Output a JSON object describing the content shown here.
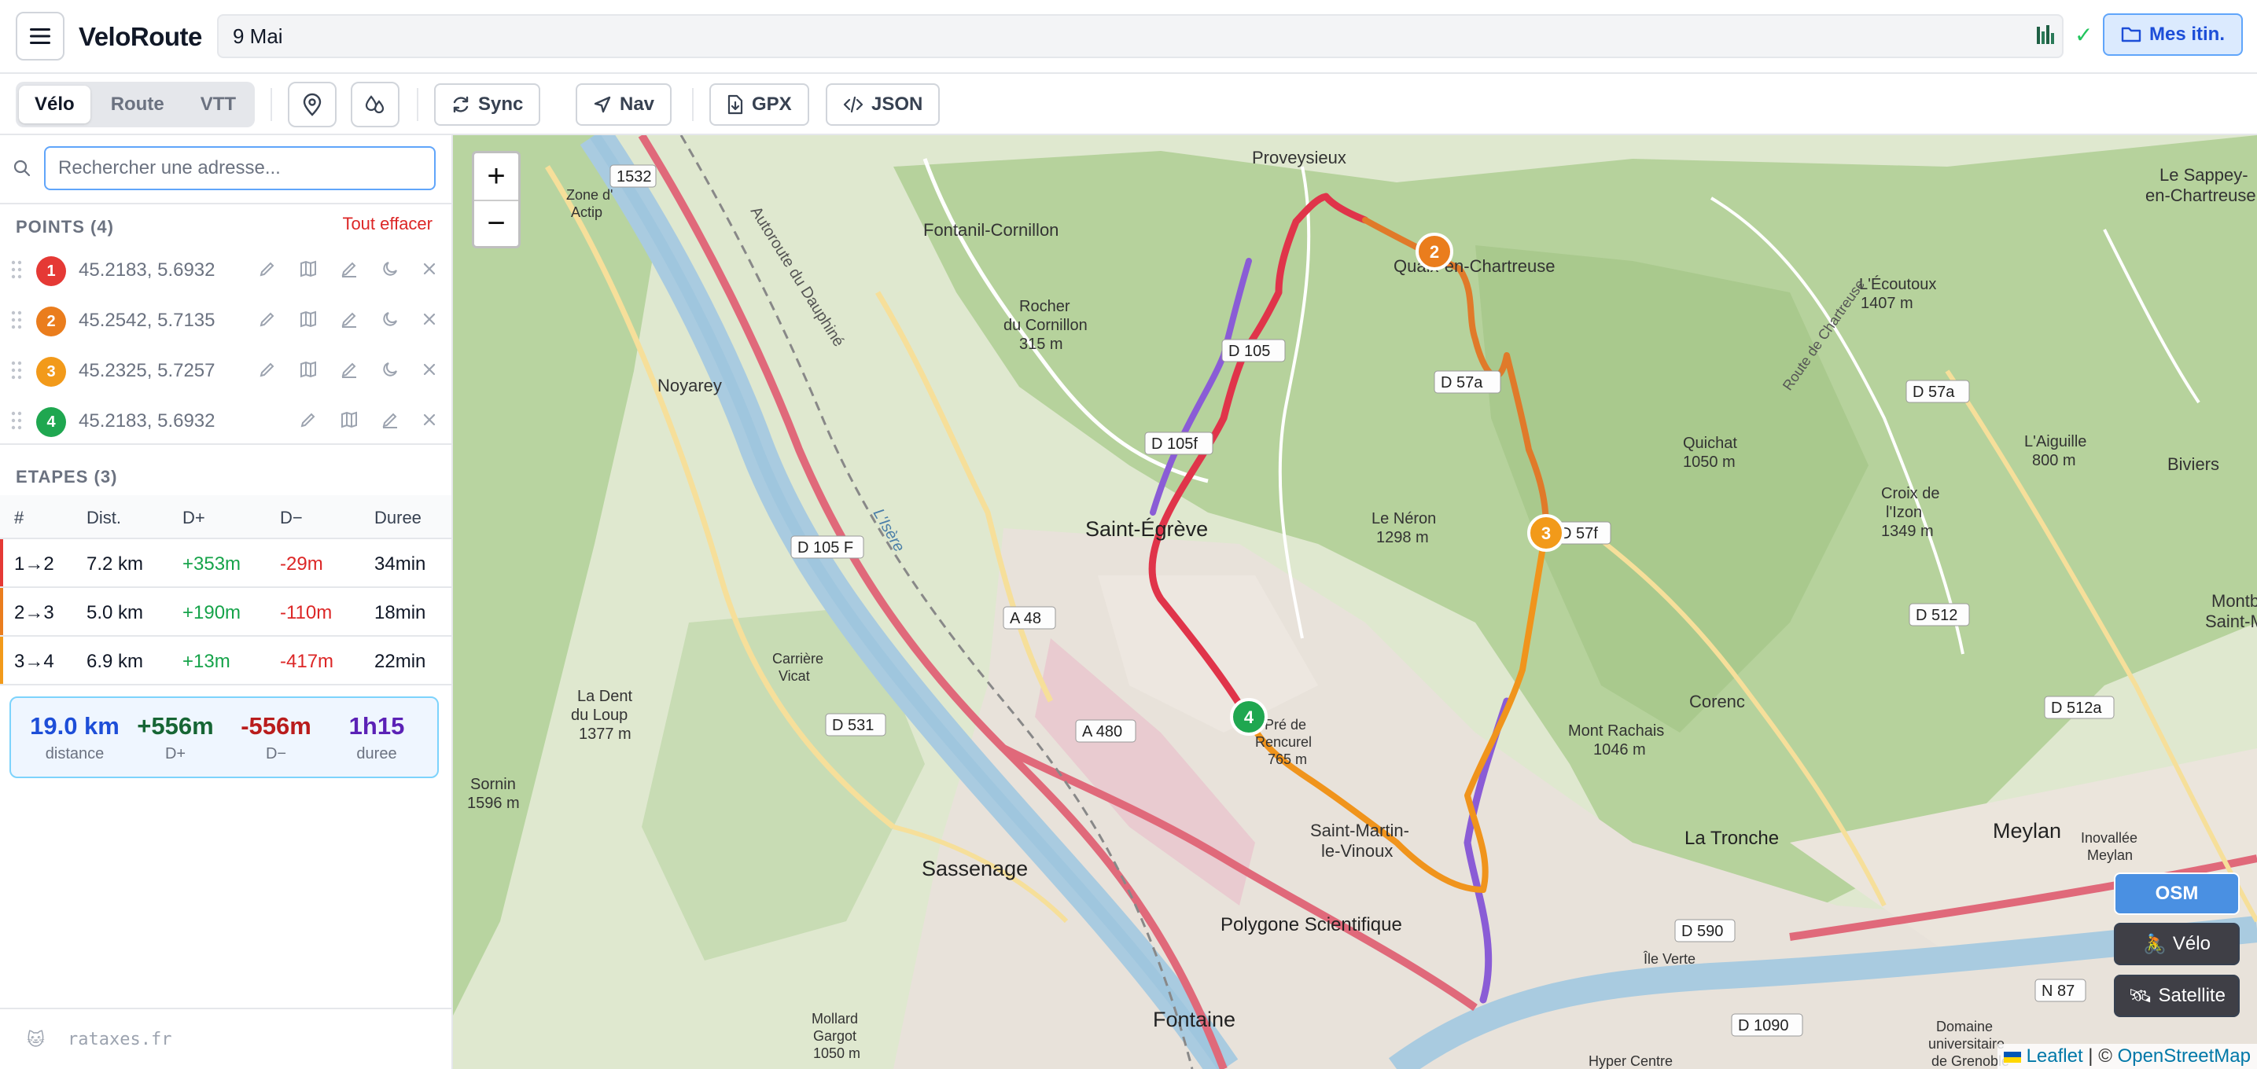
{
  "app": {
    "brand": "VeloRoute",
    "title_value": "9 Mai",
    "my_routes_label": "Mes itin."
  },
  "toolbar": {
    "modes": [
      "Vélo",
      "Route",
      "VTT"
    ],
    "active_mode": "Vélo",
    "sync_label": "Sync",
    "nav_label": "Nav",
    "gpx_label": "GPX",
    "json_label": "JSON"
  },
  "search": {
    "placeholder": "Rechercher une adresse..."
  },
  "points": {
    "title": "POINTS (4)",
    "clear_label": "Tout effacer",
    "items": [
      {
        "n": "1",
        "coord": "45.2183, 5.6932",
        "color": "#e53935"
      },
      {
        "n": "2",
        "coord": "45.2542, 5.7135",
        "color": "#ea7d1d"
      },
      {
        "n": "3",
        "coord": "45.2325, 5.7257",
        "color": "#f29a1a"
      },
      {
        "n": "4",
        "coord": "45.2183, 5.6932",
        "color": "#1fa750"
      }
    ]
  },
  "stages": {
    "title": "ETAPES (3)",
    "headers": [
      "#",
      "Dist.",
      "D+",
      "D−",
      "Duree"
    ],
    "rows": [
      {
        "seg": "1→2",
        "dist": "7.2 km",
        "up": "+353m",
        "down": "-29m",
        "dur": "34min",
        "color": "#e53935"
      },
      {
        "seg": "2→3",
        "dist": "5.0 km",
        "up": "+190m",
        "down": "-110m",
        "dur": "18min",
        "color": "#ea7d1d"
      },
      {
        "seg": "3→4",
        "dist": "6.9 km",
        "up": "+13m",
        "down": "-417m",
        "dur": "22min",
        "color": "#f29a1a"
      }
    ]
  },
  "summary": {
    "distance": "19.0 km",
    "distance_label": "distance",
    "up": "+556m",
    "up_label": "D+",
    "down": "-556m",
    "down_label": "D−",
    "duration": "1h15",
    "duration_label": "duree"
  },
  "footer": {
    "site": "rataxes.fr"
  },
  "map": {
    "zoom_in": "+",
    "zoom_out": "−",
    "layers": {
      "osm": "OSM",
      "velo": "Vélo",
      "satellite": "Satellite"
    },
    "attribution": {
      "leaflet": "Leaflet",
      "sep": " | © ",
      "osm": "OpenStreetMap"
    },
    "labels": {
      "proveysieux": "Proveysieux",
      "fontanil": "Fontanil-Cornillon",
      "noyarey": "Noyarey",
      "st_egreve": "Saint-Égrève",
      "sassenage": "Sassenage",
      "fontaine": "Fontaine",
      "polygone": "Polygone Scientifique",
      "st_martin": "Saint-Martin-",
      "st_martin2": "le-Vinoux",
      "la_tronche": "La Tronche",
      "meylan": "Meylan",
      "corenc": "Corenc",
      "biviers": "Biviers",
      "montbo": "Montbo",
      "saint_m": "Saint-M",
      "sappey": "Le Sappey-",
      "sappey2": "en-Chartreuse",
      "quaix": "Quaix-en-Chartreuse",
      "neron": "Le Néron",
      "neron_alt": "1298 m",
      "rachais": "Mont Rachais",
      "rachais_alt": "1046 m",
      "quichat": "Quichat",
      "quichat_alt": "1050 m",
      "ecoutoux": "L'Écoutoux",
      "ecoutoux_alt": "1407 m",
      "aiguille": "L'Aiguille",
      "aiguille_alt": "800 m",
      "croix": "Croix de",
      "croix2": "l'Izon",
      "croix_alt": "1349 m",
      "dent": "La Dent",
      "dent2": "du Loup",
      "dent_alt": "1377 m",
      "sornin": "Sornin",
      "sornin_alt": "1596 m",
      "rocher": "Rocher",
      "rocher2": "du Cornillon",
      "rocher_alt": "315 m",
      "zone": "Zone d'",
      "zone2": "Actip",
      "carriere": "Carrière",
      "carriere2": "Vicat",
      "pre": "Pré de",
      "pre2": "Rencurel",
      "pre_alt": "765 m",
      "mollard": "Mollard",
      "mollard2": "Gargot",
      "mollard_alt": "1050 m",
      "domaine": "Domaine",
      "domaine2": "universitaire",
      "domaine3": "de Grenoble",
      "inovallee": "Inovallée",
      "inovallee2": "Meylan",
      "ile_verte": "Île Verte",
      "autoroute": "Autoroute du Dauphiné",
      "isere": "L'Isère",
      "route_chartreuse": "Route de Chartreuse",
      "hyper": "Hyper Centre"
    },
    "shields": [
      "1532",
      "D 105",
      "D 105f",
      "D 105 F",
      "D 57a",
      "D 57a",
      "D 57f",
      "D 512",
      "D 512a",
      "A 48",
      "A 480",
      "D 531",
      "D 590",
      "D 1090",
      "N 87"
    ]
  },
  "colors": {
    "seg1": "#e0344a",
    "seg2": "#e07a2a",
    "seg3": "#f0941c",
    "alt_route": "#8a5cd6",
    "accent": "#3b82f6"
  }
}
